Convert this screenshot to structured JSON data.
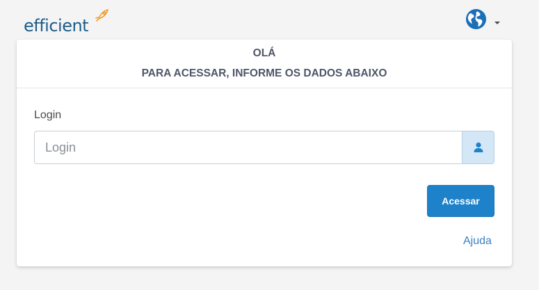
{
  "brand": {
    "logo_text": "efficient",
    "accent_color": "#1d5d86",
    "mark_color": "#f39a2c"
  },
  "header": {
    "language_icon": "globe-icon",
    "language_caret": "caret-down-icon"
  },
  "card": {
    "greeting": "OLÁ",
    "subtitle": "PARA ACESSAR, INFORME OS DADOS ABAIXO"
  },
  "form": {
    "login_label": "Login",
    "login_placeholder": "Login",
    "login_value": "",
    "login_addon_icon": "user-icon",
    "submit_label": "Acessar",
    "help_link": "Ajuda"
  },
  "colors": {
    "primary": "#1d82c9",
    "link": "#3b7fc4",
    "addon_bg": "#d4e7f7"
  }
}
